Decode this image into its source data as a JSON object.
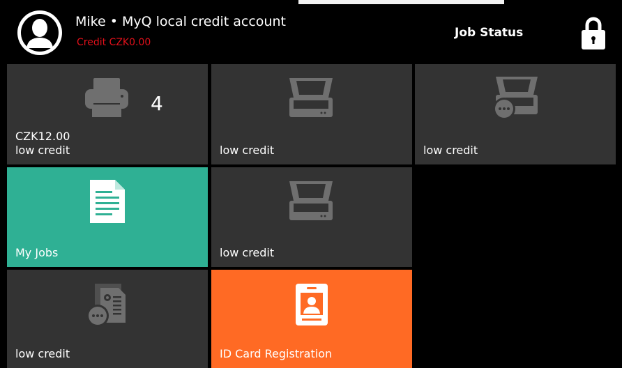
{
  "header": {
    "user_name": "Mike • MyQ local credit account",
    "credit": "Credit CZK0.00",
    "job_status_label": "Job Status"
  },
  "tiles": [
    {
      "id": "print",
      "icon": "printer-icon",
      "badge": "4",
      "line1": "CZK12.00",
      "label": "low credit"
    },
    {
      "id": "scan",
      "icon": "scanner-icon",
      "label": "low credit"
    },
    {
      "id": "scan-more",
      "icon": "scanner-more-icon",
      "label": "low credit"
    },
    {
      "id": "my-jobs",
      "icon": "document-icon",
      "label": "My Jobs",
      "color": "#2fb094"
    },
    {
      "id": "scan2",
      "icon": "scanner-icon",
      "label": "low credit"
    },
    {
      "id": "copy-more",
      "icon": "copy-document-more-icon",
      "label": "low credit"
    },
    {
      "id": "id-card",
      "icon": "id-card-icon",
      "label": "ID Card Registration",
      "color": "#ff6a24"
    }
  ],
  "colors": {
    "background": "#000000",
    "tile": "#333333",
    "icon_gray": "#6f6f6f",
    "credit_red": "#e0101a",
    "green": "#2fb094",
    "orange": "#ff6a24"
  }
}
